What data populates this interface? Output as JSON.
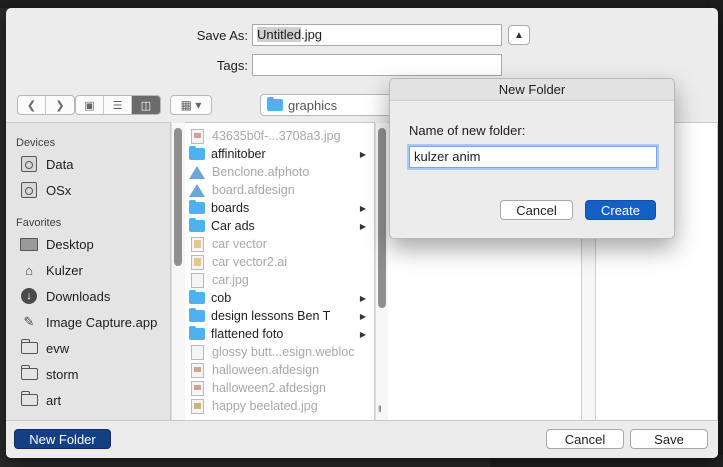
{
  "save_panel": {
    "save_as_label": "Save As:",
    "save_as_value_selected": "Untitled",
    "save_as_value_ext": ".jpg",
    "tags_label": "Tags:",
    "tags_value": "",
    "path_folder": "graphics"
  },
  "sidebar": {
    "devices_header": "Devices",
    "favorites_header": "Favorites",
    "devices": [
      {
        "label": "Data",
        "icon": "disk-icon"
      },
      {
        "label": "OSx",
        "icon": "disk-icon"
      }
    ],
    "favorites": [
      {
        "label": "Desktop",
        "icon": "desktop-icon"
      },
      {
        "label": "Kulzer",
        "icon": "home-icon"
      },
      {
        "label": "Downloads",
        "icon": "download-icon"
      },
      {
        "label": "Image Capture.app",
        "icon": "app-icon"
      },
      {
        "label": "evw",
        "icon": "folder-icon"
      },
      {
        "label": "storm",
        "icon": "folder-icon"
      },
      {
        "label": "art",
        "icon": "folder-icon"
      }
    ]
  },
  "file_list": [
    {
      "name": "43635b0f-...3708a3.jpg",
      "kind": "image",
      "disabled": true,
      "has_children": false
    },
    {
      "name": "affinitober",
      "kind": "folder",
      "disabled": false,
      "has_children": true
    },
    {
      "name": "Benclone.afphoto",
      "kind": "affinity",
      "disabled": true,
      "has_children": false
    },
    {
      "name": "board.afdesign",
      "kind": "affinity",
      "disabled": true,
      "has_children": false
    },
    {
      "name": "boards",
      "kind": "folder",
      "disabled": false,
      "has_children": true
    },
    {
      "name": "Car ads",
      "kind": "folder",
      "disabled": false,
      "has_children": true
    },
    {
      "name": "car vector",
      "kind": "ai",
      "disabled": true,
      "has_children": false
    },
    {
      "name": "car vector2.ai",
      "kind": "ai",
      "disabled": true,
      "has_children": false
    },
    {
      "name": "car.jpg",
      "kind": "doc",
      "disabled": true,
      "has_children": false
    },
    {
      "name": "cob",
      "kind": "folder",
      "disabled": false,
      "has_children": true
    },
    {
      "name": "design lessons Ben T",
      "kind": "folder",
      "disabled": false,
      "has_children": true
    },
    {
      "name": "flattened foto",
      "kind": "folder",
      "disabled": false,
      "has_children": true
    },
    {
      "name": "glossy butt...esign.webloc",
      "kind": "doc",
      "disabled": true,
      "has_children": false
    },
    {
      "name": "halloween.afdesign",
      "kind": "image",
      "disabled": true,
      "has_children": false
    },
    {
      "name": "halloween2.afdesign",
      "kind": "image",
      "disabled": true,
      "has_children": false
    },
    {
      "name": "happy beelated.jpg",
      "kind": "jpg",
      "disabled": true,
      "has_children": false
    }
  ],
  "footer": {
    "new_folder_label": "New Folder",
    "cancel_label": "Cancel",
    "save_label": "Save"
  },
  "new_folder_sheet": {
    "title": "New Folder",
    "prompt": "Name of new folder:",
    "value": "kulzer anim",
    "cancel_label": "Cancel",
    "create_label": "Create"
  },
  "colors": {
    "accent": "#1560c4",
    "folder": "#4fb1ef"
  }
}
